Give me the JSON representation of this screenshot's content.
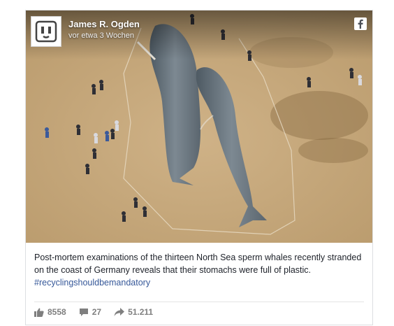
{
  "post": {
    "author": "James R. Ogden",
    "timestamp": "vor etwa 3 Wochen",
    "caption_text": "Post-mortem examinations of the thirteen North Sea sperm whales recently stranded on the coast of Germany reveals that their stomachs were full of plastic. ",
    "hashtag": "#recyclingshouldbemandatory"
  },
  "stats": {
    "likes": "8558",
    "comments": "27",
    "shares": "51.211"
  },
  "icons": {
    "avatar": "outlet-logo-icon",
    "platform": "facebook-icon",
    "like": "thumbs-up-icon",
    "comment": "comment-icon",
    "share": "share-arrow-icon"
  },
  "colors": {
    "link": "#365899",
    "text": "#1d2129",
    "muted": "#7f7f7f",
    "sand": "#c9ab7e"
  }
}
